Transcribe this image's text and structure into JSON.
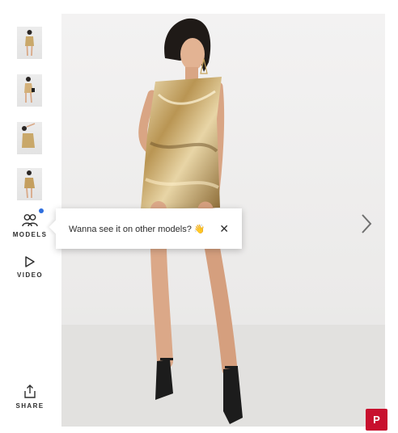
{
  "thumbnails": [
    {
      "icon": "product-thumbnail-front"
    },
    {
      "icon": "product-thumbnail-back"
    },
    {
      "icon": "product-thumbnail-closeup"
    },
    {
      "icon": "product-thumbnail-side"
    }
  ],
  "models_button": {
    "label": "MODELS",
    "icon": "models-icon",
    "badge_color": "#2f6fde"
  },
  "video_button": {
    "label": "VIDEO",
    "icon": "play-icon"
  },
  "share_button": {
    "label": "SHARE",
    "icon": "share-icon"
  },
  "tooltip": {
    "text": "Wanna see it on other models? 👋",
    "close_symbol": "✕"
  },
  "next_arrow": {
    "icon": "chevron-right-icon"
  },
  "pinterest": {
    "symbol": "P",
    "color": "#c8102e"
  }
}
